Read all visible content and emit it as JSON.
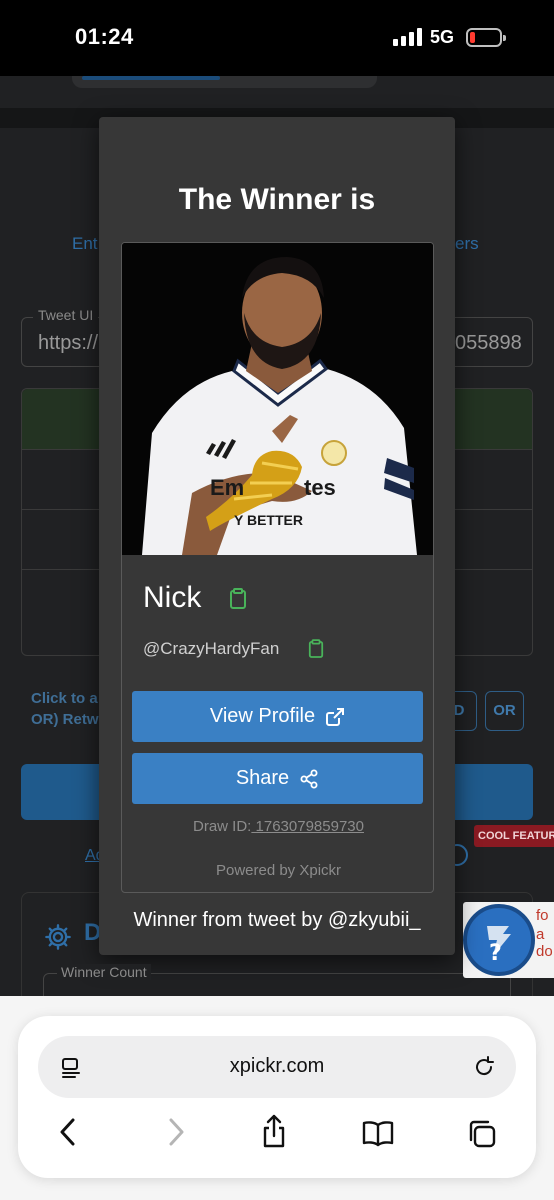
{
  "status_bar": {
    "time": "01:24",
    "network": "5G",
    "battery_level": 0.15,
    "battery_color": "#ff3b30"
  },
  "background_page": {
    "tabs_left": "Ent",
    "tabs_right": "ers",
    "tweet_url_label": "Tweet UI",
    "tweet_url_value_left": "https://",
    "tweet_url_value_right": "055898",
    "click_text_line1": "Click to a",
    "click_text_line2": "OR) Retw",
    "chip_and": "D",
    "chip_or": "OR",
    "cool_feature": "COOL FEATURE",
    "advanced_link": "Ad",
    "section_title": "D",
    "winner_count_label": "Winner Count",
    "recaptcha_text_1": "fo",
    "recaptcha_text_2": "a do"
  },
  "modal": {
    "title": "The Winner is",
    "winner": {
      "name": "Nick",
      "handle": "@CrazyHardyFan"
    },
    "view_profile_label": "View Profile",
    "share_label": "Share",
    "draw_id_label": "Draw ID:",
    "draw_id_value": " 1763079859730",
    "powered_by": "Powered by Xpickr",
    "tweet_credit": "Winner from tweet by @zkyubii_"
  },
  "browser": {
    "url": "xpickr.com"
  },
  "icons": {
    "copy": "clipboard-icon",
    "external": "external-link-icon",
    "share": "share-nodes-icon",
    "reader": "page-menu-icon",
    "reload": "reload-icon",
    "back": "chevron-left-icon",
    "forward": "chevron-right-icon",
    "share_sheet": "share-sheet-icon",
    "bookmarks": "book-icon",
    "tabs": "tabs-icon"
  },
  "colors": {
    "accent_blue": "#3a80c4",
    "copy_green": "#49b35a"
  }
}
